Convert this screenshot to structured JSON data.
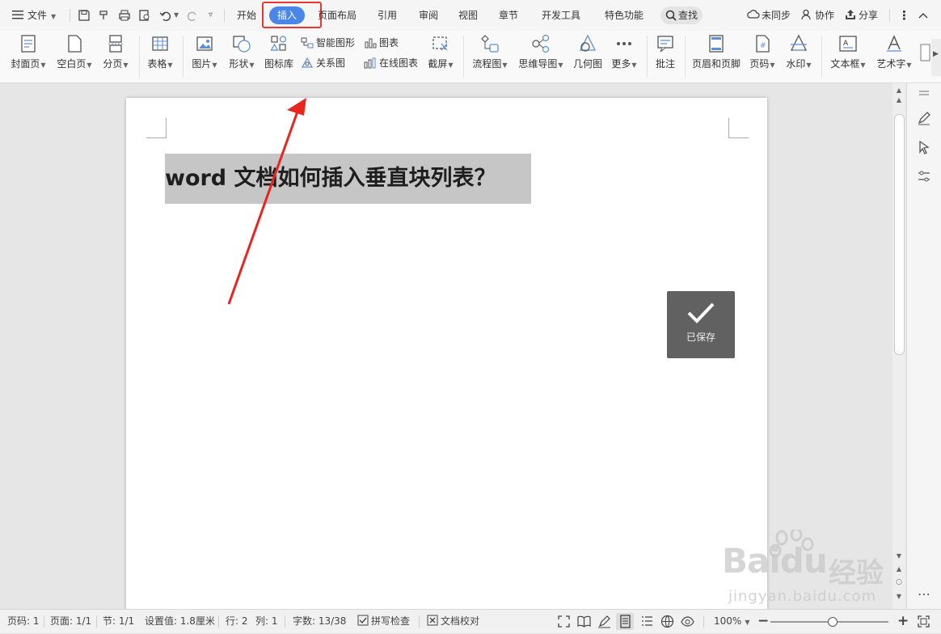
{
  "menubar": {
    "menu_label": "文件",
    "tabs": [
      "开始",
      "插入",
      "页面布局",
      "引用",
      "审阅",
      "视图",
      "章节",
      "开发工具",
      "特色功能"
    ],
    "active_tab": "插入",
    "search_label": "查找",
    "sync_label": "未同步",
    "collab_label": "协作",
    "share_label": "分享"
  },
  "ribbon": {
    "cover_page": "封面页",
    "blank_page": "空白页",
    "page_break": "分页",
    "table": "表格",
    "picture": "图片",
    "shapes": "形状",
    "icon_library": "图标库",
    "smart_graphic": "智能图形",
    "chart": "图表",
    "relation_graph": "关系图",
    "online_chart": "在线图表",
    "screenshot": "截屏",
    "flowchart": "流程图",
    "mindmap": "思维导图",
    "geometry": "几何图",
    "more": "更多",
    "comment": "批注",
    "header_footer": "页眉和页脚",
    "page_number": "页码",
    "watermark": "水印",
    "textbox": "文本框",
    "wordart": "艺术字"
  },
  "document": {
    "title": "word 文档如何插入垂直块列表？",
    "saved_toast": "已保存"
  },
  "statusbar": {
    "page_code": "页码: 1",
    "pages": "页面: 1/1",
    "section": "节: 1/1",
    "setting_value": "设置值: 1.8厘米",
    "row": "行: 2",
    "column": "列: 1",
    "word_count": "字数: 13/38",
    "spell_check": "拼写检查",
    "doc_proof": "文档校对",
    "zoom": "100%",
    "zoom_level": 1.0
  },
  "watermark": {
    "brand": "Baidu",
    "brand_cn": "经验",
    "url": "jingyan.baidu.com"
  },
  "colors": {
    "active_tab": "#4a86e8",
    "highlight_box": "#e53935",
    "annotation_arrow": "#e8261f",
    "title_highlight": "#c6c6c6",
    "toast_bg": "#616161"
  }
}
